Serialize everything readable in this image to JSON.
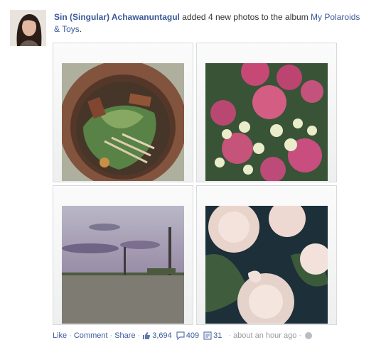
{
  "story": {
    "actor_name": "Sin (Singular) Achawanuntagul",
    "action_text": " added 4 new photos to the album ",
    "album_name": "My Polaroids & Toys",
    "album_suffix": "."
  },
  "photos": [
    {
      "alt": "clay pot noodle soup"
    },
    {
      "alt": "pink and white flowers"
    },
    {
      "alt": "cloudy sky over field"
    },
    {
      "alt": "pale roses"
    }
  ],
  "footer": {
    "like": "Like",
    "comment": "Comment",
    "share": "Share",
    "likes_count": "3,694",
    "comments_count": "409",
    "shares_count": "31",
    "timestamp": "about an hour ago",
    "sep": "·",
    "privacy_icon": "globe-icon"
  },
  "colors": {
    "link": "#3b5998",
    "muted": "#999999"
  }
}
